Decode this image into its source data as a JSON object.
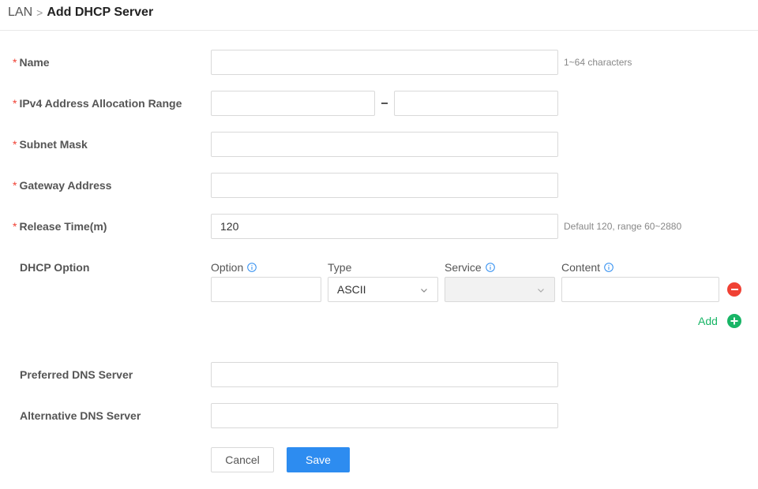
{
  "breadcrumb": {
    "parent": "LAN",
    "separator": ">",
    "current": "Add DHCP Server"
  },
  "fields": {
    "name": {
      "label": "Name",
      "value": "",
      "hint": "1~64 characters"
    },
    "ipv4_range": {
      "label": "IPv4 Address Allocation Range",
      "start_value": "",
      "end_value": ""
    },
    "subnet_mask": {
      "label": "Subnet Mask",
      "value": ""
    },
    "gateway": {
      "label": "Gateway Address",
      "value": ""
    },
    "release_time": {
      "label": "Release Time(m)",
      "value": "120",
      "hint": "Default 120, range 60~2880"
    },
    "preferred_dns": {
      "label": "Preferred DNS Server",
      "value": ""
    },
    "alternative_dns": {
      "label": "Alternative DNS Server",
      "value": ""
    }
  },
  "dhcp_option": {
    "label": "DHCP Option",
    "columns": {
      "option": "Option",
      "type": "Type",
      "service": "Service",
      "content": "Content"
    },
    "row": {
      "option": "",
      "type": "ASCII",
      "service": "",
      "content": ""
    },
    "add_label": "Add"
  },
  "buttons": {
    "cancel": "Cancel",
    "save": "Save"
  },
  "colors": {
    "required": "#f04134",
    "primary": "#2d8cf0",
    "add": "#18b566",
    "remove": "#f04134",
    "info": "#2d8cf0"
  },
  "icons": {
    "info": "info-circle-icon",
    "chevron": "chevron-down-icon",
    "remove": "minus-circle-icon",
    "add": "plus-circle-icon"
  }
}
